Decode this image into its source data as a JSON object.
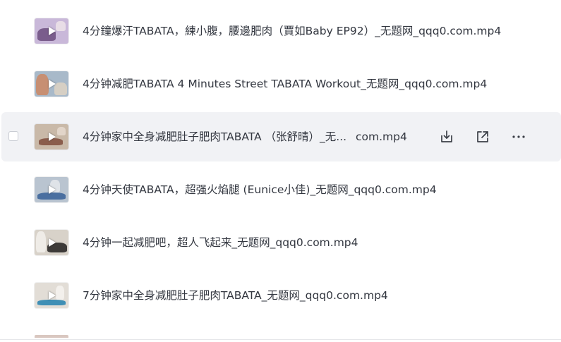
{
  "files": [
    {
      "name_full": "4分鐘爆汗TABATA，練小腹，腰邊肥肉（賈如Baby EP92）_无题网_qqq0.com.mp4",
      "thumb_colors": [
        "#c9b8d9",
        "#7a5d8c",
        "#e8dde6"
      ]
    },
    {
      "name_full": "4分钟减肥TABATA 4 Minutes Street TABATA Workout_无题网_qqq0.com.mp4",
      "thumb_colors": [
        "#a8b9c9",
        "#c78f73",
        "#d6cfc4"
      ]
    },
    {
      "name_start": "4分钟家中全身减肥肚子肥肉TABATA （张舒晴）_无...",
      "name_end": "com.mp4",
      "thumb_colors": [
        "#c9b9a8",
        "#8a5d4c",
        "#e2d5c9"
      ],
      "hovered": true,
      "actions": [
        {
          "icon": "download-icon",
          "tooltip": ""
        },
        {
          "icon": "share-icon",
          "tooltip": ""
        },
        {
          "icon": "more-icon",
          "tooltip": ""
        }
      ]
    },
    {
      "name_full": "4分钟天使TABATA，超强火焰腿 (Eunice小佳)_无题网_qqq0.com.mp4",
      "thumb_colors": [
        "#b9c4d0",
        "#4a6fa0",
        "#dfe3e8"
      ]
    },
    {
      "name_full": "4分钟一起减肥吧，超人飞起来_无题网_qqq0.com.mp4",
      "thumb_colors": [
        "#d8d2c9",
        "#3d3a38",
        "#efece7"
      ]
    },
    {
      "name_full": "7分钟家中全身减肥肚子肥肉TABATA_无题网_qqq0.com.mp4",
      "thumb_colors": [
        "#e2ddd6",
        "#3f8fb5",
        "#f3f0ec"
      ]
    }
  ]
}
